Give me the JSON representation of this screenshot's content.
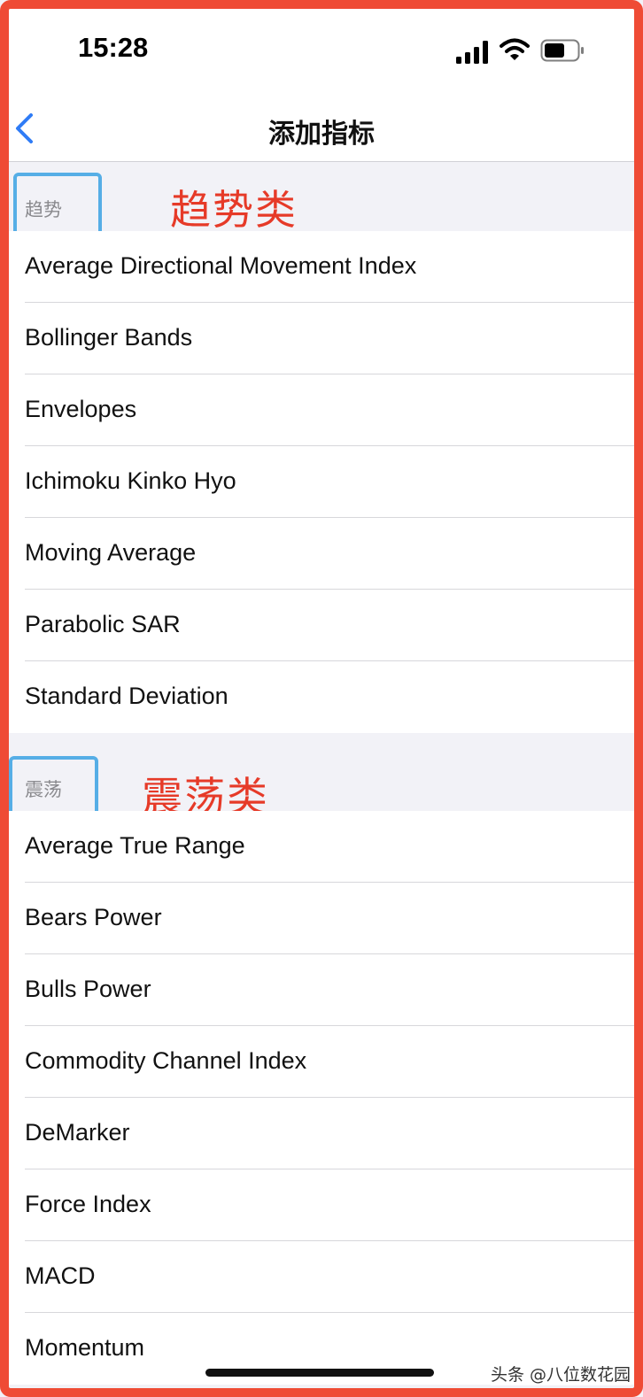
{
  "status_bar": {
    "time": "15:28"
  },
  "nav": {
    "title": "添加指标"
  },
  "sections": [
    {
      "header": "趋势",
      "annotation": "趋势类",
      "items": [
        "Average Directional Movement Index",
        "Bollinger Bands",
        "Envelopes",
        "Ichimoku Kinko Hyo",
        "Moving Average",
        "Parabolic SAR",
        "Standard Deviation"
      ]
    },
    {
      "header": "震荡",
      "annotation": "震荡类",
      "items": [
        "Average True Range",
        "Bears Power",
        "Bulls Power",
        "Commodity Channel Index",
        "DeMarker",
        "Force Index",
        "MACD",
        "Momentum"
      ]
    }
  ],
  "watermark": "头条 @八位数花园",
  "colors": {
    "annotation": "#e63a28",
    "highlight_box": "#56aee6",
    "back_icon": "#2f7cf6",
    "frame": "#ef4b35"
  },
  "icons": {
    "back": "chevron-left-icon",
    "signal": "cellular-signal-icon",
    "wifi": "wifi-icon",
    "battery": "battery-icon"
  }
}
